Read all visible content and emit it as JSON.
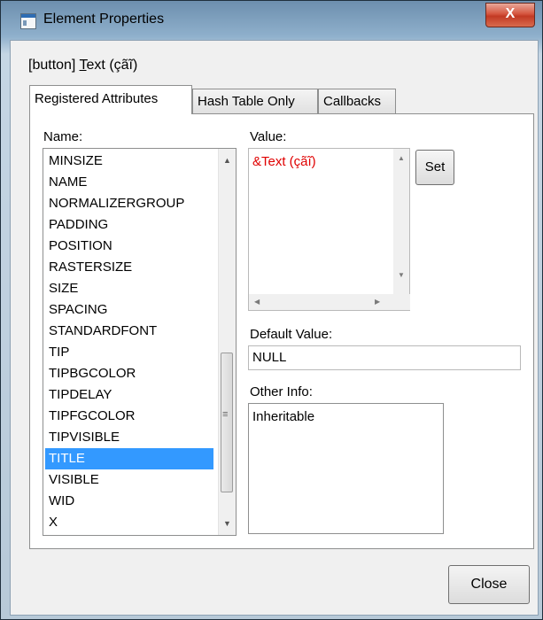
{
  "window": {
    "title": "Element Properties",
    "close_symbol": "X"
  },
  "element_label": {
    "prefix": "[button] ",
    "mnemonic": "T",
    "rest": "ext (çãĩ)"
  },
  "tabs": [
    {
      "label": "Registered Attributes",
      "active": true
    },
    {
      "label": "Hash Table Only",
      "active": false
    },
    {
      "label": "Callbacks",
      "active": false
    }
  ],
  "names": {
    "label": "Name:",
    "items": [
      "MINSIZE",
      "NAME",
      "NORMALIZERGROUP",
      "PADDING",
      "POSITION",
      "RASTERSIZE",
      "SIZE",
      "SPACING",
      "STANDARDFONT",
      "TIP",
      "TIPBGCOLOR",
      "TIPDELAY",
      "TIPFGCOLOR",
      "TIPVISIBLE",
      "TITLE",
      "VISIBLE",
      "WID",
      "X"
    ],
    "selected": "TITLE"
  },
  "value": {
    "label": "Value:",
    "text": "&Text (çãĩ)",
    "text_color": "#e00000",
    "set_label": "Set"
  },
  "default_value": {
    "label": "Default Value:",
    "value": "NULL"
  },
  "other_info": {
    "label": "Other Info:",
    "text": "Inheritable"
  },
  "close_label": "Close",
  "colors": {
    "selection": "#3399ff",
    "close_button": "#c23a24"
  }
}
